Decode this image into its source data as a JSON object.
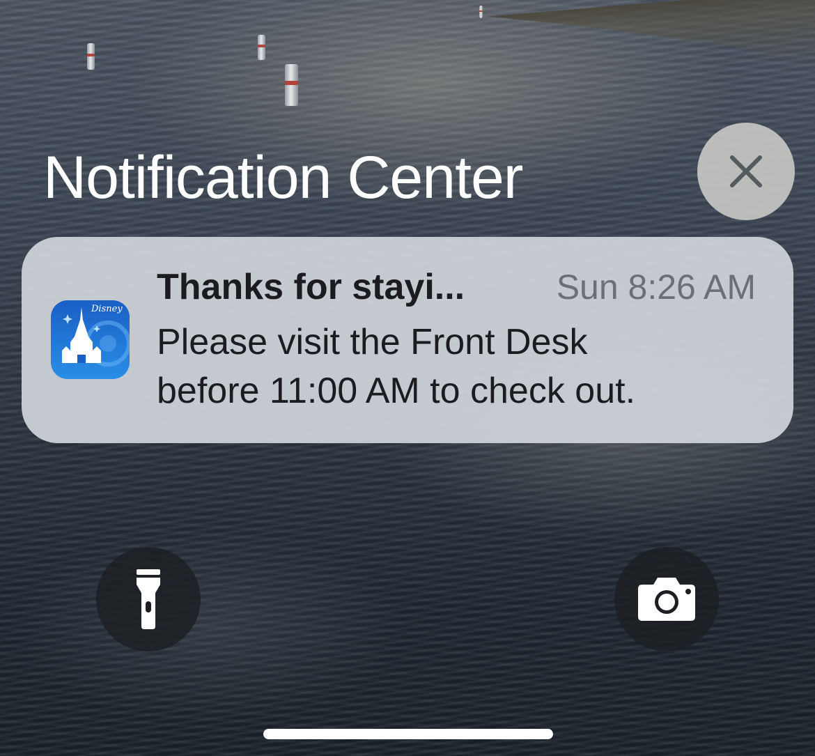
{
  "notification_center": {
    "title": "Notification Center",
    "close_icon": "close-icon"
  },
  "notification": {
    "app": "Disney",
    "app_icon": "disney-castle-icon",
    "app_icon_wordmark": "Disney",
    "title": "Thanks for stayi...",
    "time": "Sun 8:26 AM",
    "body_line1": "Please visit the Front Desk",
    "body_line2": "before 11:00 AM to check out."
  },
  "lock_screen": {
    "flashlight_icon": "flashlight-icon",
    "camera_icon": "camera-icon"
  },
  "colors": {
    "card_background": "#d0d4da",
    "app_icon_blue": "#1b6fd1",
    "button_dark": "#1c1e22",
    "text_primary": "#1c1c1e",
    "text_secondary": "#6b6f76"
  }
}
